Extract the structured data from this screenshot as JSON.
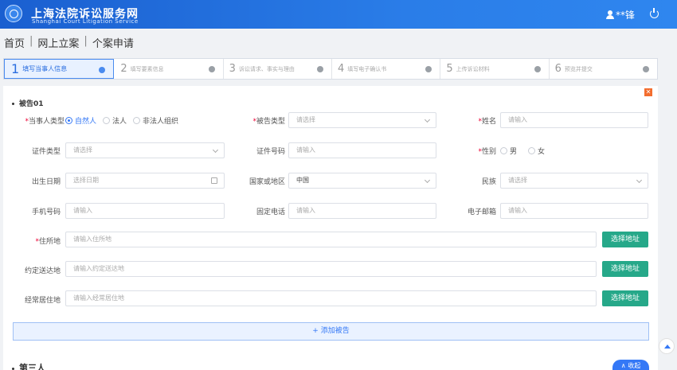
{
  "header": {
    "title_cn": "上海法院诉讼服务网",
    "title_en": "Shanghai Court Litigation Service",
    "user": "**锋"
  },
  "breadcrumb": [
    "首页",
    "网上立案",
    "个案申请"
  ],
  "breadcrumb_separator": "|",
  "steps": [
    {
      "num": "1",
      "label": "填写当事人信息"
    },
    {
      "num": "2",
      "label": "填写要素信息"
    },
    {
      "num": "3",
      "label": "诉讼请求、事实与理由"
    },
    {
      "num": "4",
      "label": "填写电子确认书"
    },
    {
      "num": "5",
      "label": "上传诉讼材料"
    },
    {
      "num": "6",
      "label": "预览并提交"
    }
  ],
  "section": {
    "title": "被告01",
    "close_icon": "✕"
  },
  "form": {
    "party_type": {
      "label": "当事人类型",
      "options": [
        "自然人",
        "法人",
        "非法人组织"
      ],
      "selected": "自然人"
    },
    "defendant_type": {
      "label": "被告类型",
      "placeholder": "请选择"
    },
    "name": {
      "label": "姓名",
      "placeholder": "请输入"
    },
    "id_type": {
      "label": "证件类型",
      "placeholder": "请选择"
    },
    "id_number": {
      "label": "证件号码",
      "placeholder": "请输入"
    },
    "gender": {
      "label": "性别",
      "options": [
        "男",
        "女"
      ]
    },
    "birth_date": {
      "label": "出生日期",
      "placeholder": "选择日期"
    },
    "country": {
      "label": "国家或地区",
      "value": "中国"
    },
    "ethnicity": {
      "label": "民族",
      "placeholder": "请选择"
    },
    "mobile": {
      "label": "手机号码",
      "placeholder": "请输入"
    },
    "landline": {
      "label": "固定电话",
      "placeholder": "请输入"
    },
    "email": {
      "label": "电子邮箱",
      "placeholder": "请输入"
    },
    "residence": {
      "label": "住所地",
      "placeholder": "请输入住所地",
      "button": "选择地址"
    },
    "service_address": {
      "label": "约定送达地",
      "placeholder": "请输入约定送达地",
      "button": "选择地址"
    },
    "habitual_residence": {
      "label": "经常居住地",
      "placeholder": "请输入经常居住地",
      "button": "选择地址"
    }
  },
  "add_defendant": "+ 添加被告",
  "next_section_title": "第三人",
  "collapse_button": "∧ 收起",
  "colors": {
    "primary": "#3478f6",
    "header": "#2a7de8",
    "address_button": "#26a889",
    "close": "#f36d2e"
  }
}
